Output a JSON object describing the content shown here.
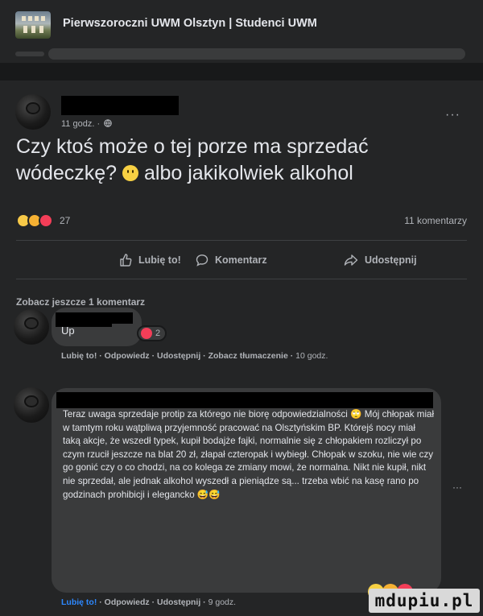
{
  "group": {
    "title": "Pierwszoroczni UWM Olsztyn | Studenci UWM"
  },
  "post": {
    "time": "11 godz. ·",
    "more": "···",
    "text_part1": "Czy ktoś może o tej porze ma sprzedać wódeczkę?",
    "text_part2": "albo jakikolwiek alkohol",
    "reaction_count": "27",
    "comment_count": "11 komentarzy",
    "actions": {
      "like": "Lubię to!",
      "comment": "Komentarz",
      "share": "Udostępnij"
    },
    "see_more_comments": "Zobacz jeszcze 1 komentarz"
  },
  "comments": [
    {
      "text": "Up",
      "reactions": "2",
      "links": {
        "like": "Lubię to!",
        "reply": "Odpowiedz",
        "share": "Udostępnij",
        "translate": "Zobacz tłumaczenie",
        "time": "10 godz."
      }
    },
    {
      "text": "Teraz uwaga sprzedaje protip za którego nie biorę odpowiedzialności 🙄 Mój chłopak miał w tamtym roku wątpliwą przyjemność pracować na Olsztyńskim BP. Którejś nocy miał taką akcje, że wszedł typek, kupił bodajże fajki, normalnie się z chłopakiem rozliczył po czym rzucił jeszcze na blat 20 zł, złapał czteropak i wybiegł. Chłopak w szoku, nie wie czy go gonić czy o co chodzi, na co kolega ze zmiany mowi, że normalna. Nikt nie kupił, nikt nie sprzedał, ale jednak alkohol wyszedł a pieniądze są... trzeba wbić na kasę rano po godzinach prohibicji i elegancko 😅😅",
      "more": "···",
      "links": {
        "like": "Lubię to!",
        "reply": "Odpowiedz",
        "share": "Udostępnij",
        "time": "9 godz."
      }
    }
  ],
  "watermark": "mdupiu.pl",
  "colors": {
    "background": "#18191a",
    "card": "#242526",
    "bubble": "#3a3b3c",
    "text": "#e4e6eb",
    "secondary": "#b0b3b8",
    "link_blue": "#2d88ff"
  }
}
